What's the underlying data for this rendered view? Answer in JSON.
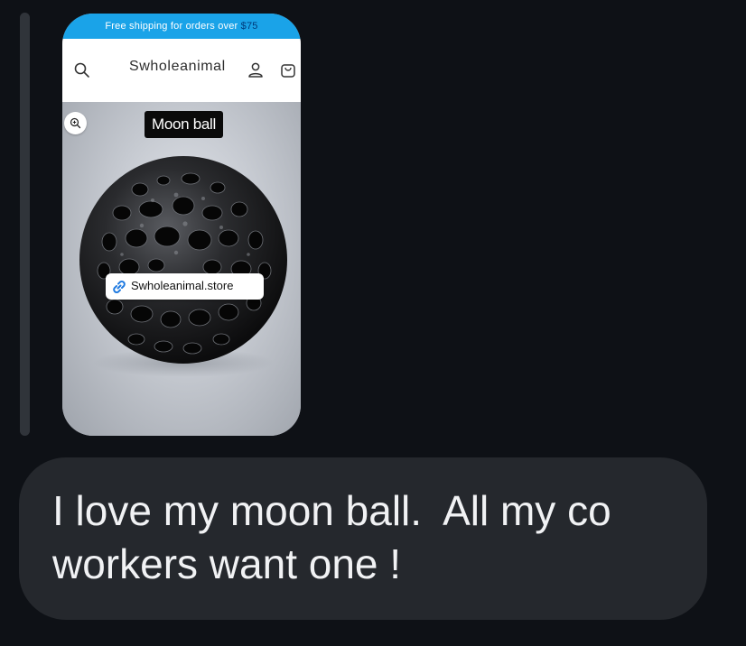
{
  "promo": {
    "text": "Free shipping for orders over ",
    "amount": "$75"
  },
  "store": {
    "name": "Swholeanimal"
  },
  "header_icons": [
    "search-icon",
    "account-icon",
    "cart-icon"
  ],
  "product": {
    "label": "Moon ball",
    "link_text": "Swholeanimal.store",
    "zoom_icon": "zoom-in-icon",
    "link_icon": "chain-link-icon"
  },
  "message": {
    "text": "I love my moon ball.  All my co\nworkers want one !"
  },
  "colors": {
    "promo_bar": "#1aa3e8",
    "bubble": "#25282d",
    "background": "#0e1116",
    "link_icon": "#1f7ae0"
  }
}
